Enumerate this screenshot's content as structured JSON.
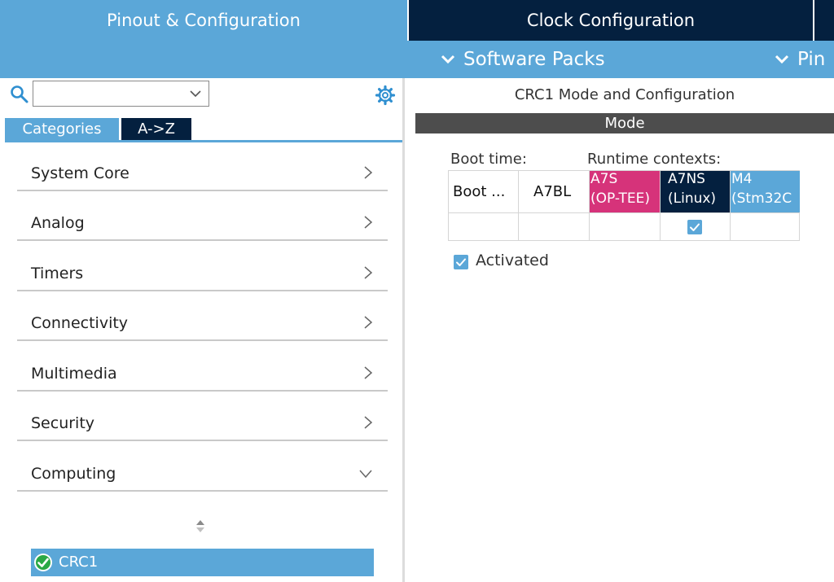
{
  "top_tabs": {
    "pinout": "Pinout & Configuration",
    "clock": "Clock Configuration"
  },
  "menu_bar": {
    "software_packs": "Software Packs",
    "pinout": "Pin"
  },
  "search": {
    "value": "",
    "placeholder": ""
  },
  "category_tabs": {
    "categories": "Categories",
    "az": "A->Z"
  },
  "categories": [
    {
      "label": "System Core",
      "expanded": false
    },
    {
      "label": "Analog",
      "expanded": false
    },
    {
      "label": "Timers",
      "expanded": false
    },
    {
      "label": "Connectivity",
      "expanded": false
    },
    {
      "label": "Multimedia",
      "expanded": false
    },
    {
      "label": "Security",
      "expanded": false
    },
    {
      "label": "Computing",
      "expanded": true
    }
  ],
  "computing_items": [
    {
      "label": "CRC1",
      "enabled": true
    }
  ],
  "config_panel": {
    "title": "CRC1 Mode and Configuration",
    "mode_header": "Mode",
    "boot_time_label": "Boot time:",
    "runtime_label": "Runtime contexts:",
    "columns": [
      {
        "line1": "Boot ...",
        "line2": ""
      },
      {
        "line1": "A7BL",
        "line2": ""
      },
      {
        "line1": "A7S",
        "line2": "(OP-TEE)",
        "color": "#d6337a"
      },
      {
        "line1": "A7NS",
        "line2": "(Linux)",
        "color": "#04203f"
      },
      {
        "line1": "M4",
        "line2": "(Stm32C",
        "color": "#5ba7d8"
      }
    ],
    "checked_context": "A7NS (Linux)",
    "activated_label": "Activated",
    "activated": true
  },
  "colors": {
    "accent_blue": "#5ba7d8",
    "dark_navy": "#04203f",
    "magenta": "#d6337a",
    "mode_gray": "#4d4d4d"
  }
}
